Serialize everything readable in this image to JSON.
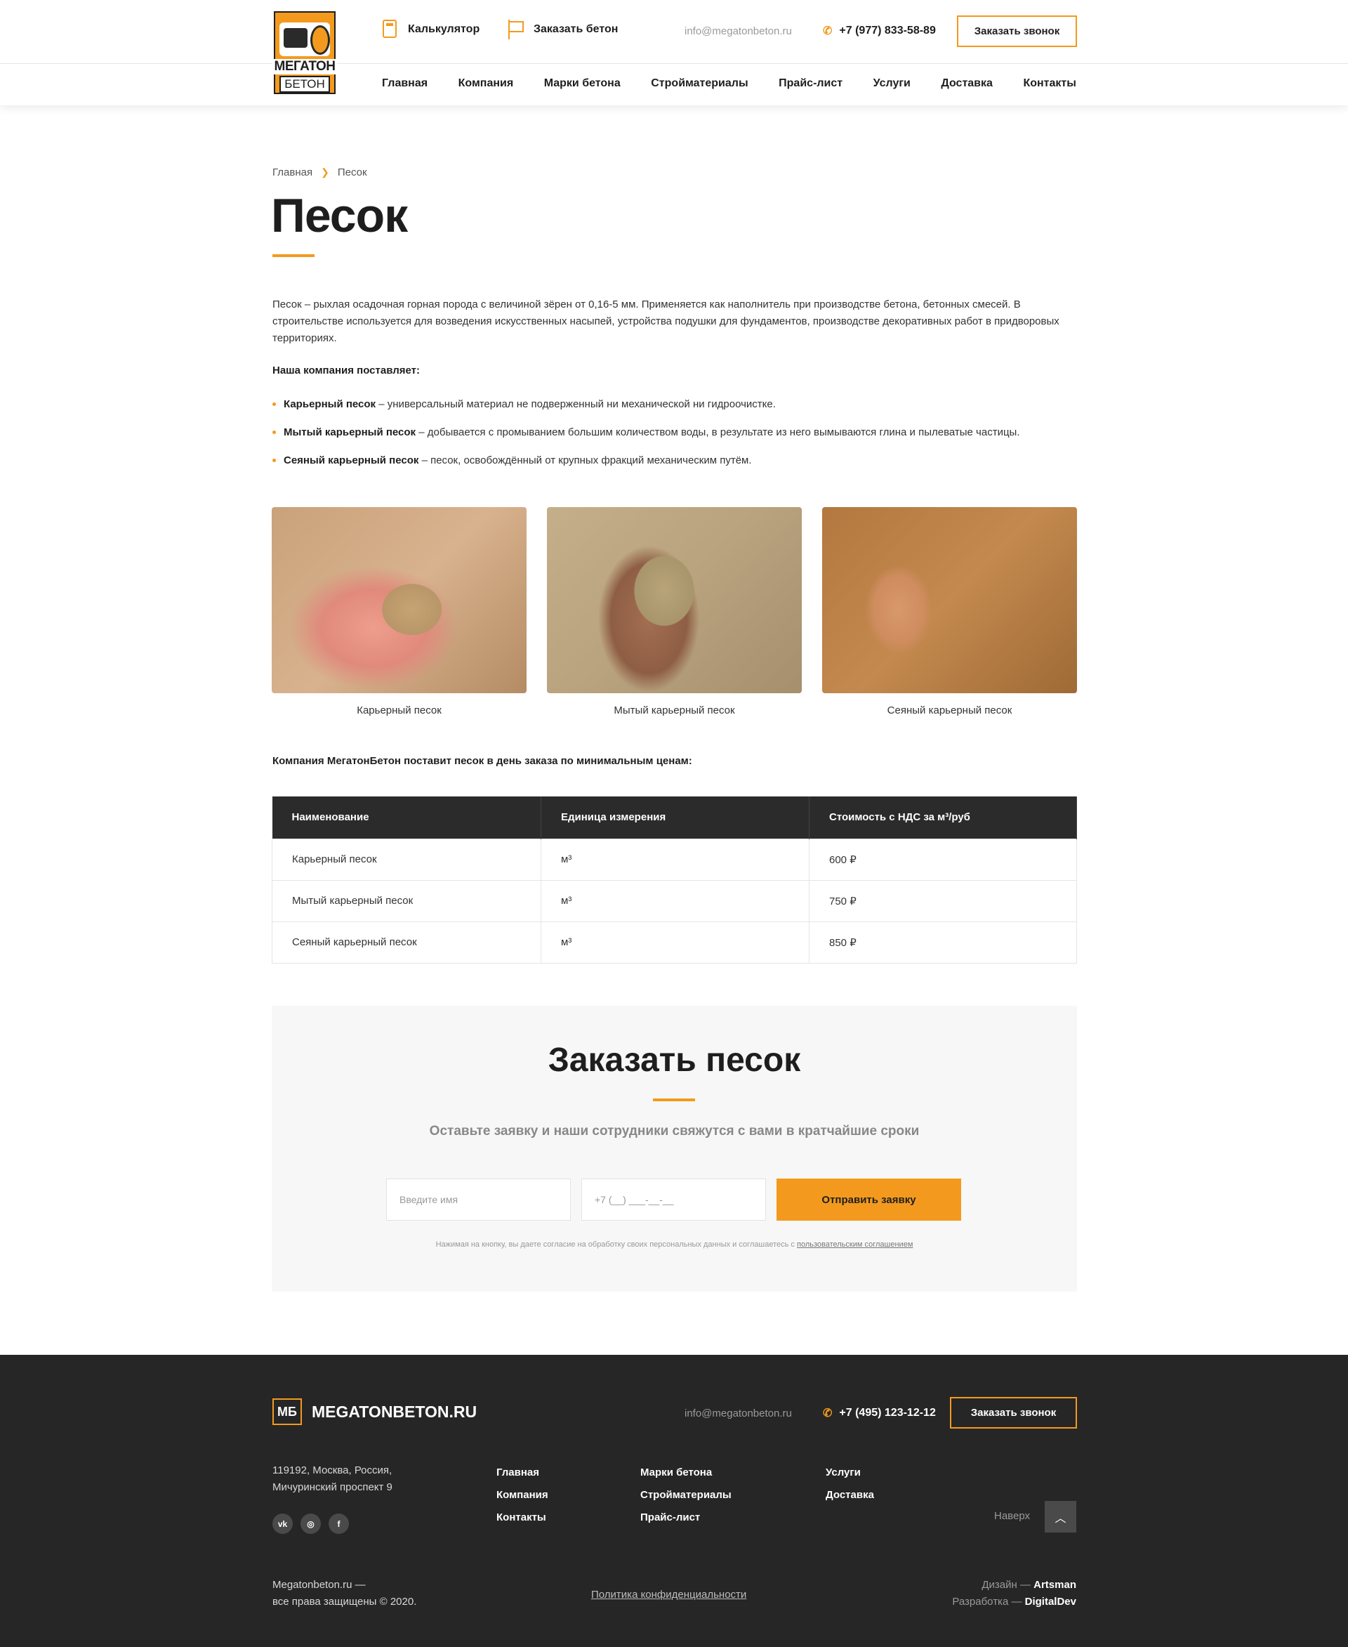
{
  "header": {
    "logo_line1": "МЕГАТОН",
    "logo_line2": "БЕТОН",
    "calculator": "Калькулятор",
    "order_concrete": "Заказать бетон",
    "email": "info@megatonbeton.ru",
    "phone": "+7 (977) 833-58-89",
    "callback": "Заказать звонок",
    "nav": [
      "Главная",
      "Компания",
      "Марки бетона",
      "Стройматериалы",
      "Прайс-лист",
      "Услуги",
      "Доставка",
      "Контакты"
    ]
  },
  "breadcrumb": {
    "home": "Главная",
    "current": "Песок"
  },
  "page_title": "Песок",
  "intro": "Песок – рыхлая осадочная горная порода с величиной зёрен от 0,16-5 мм. Применяется как наполнитель при производстве бетона, бетонных смесей. В строительстве используется для возведения искусственных насыпей, устройства подушки для фундаментов, производстве декоративных работ в придворовых территориях.",
  "supply_heading": "Наша компания поставляет:",
  "products": [
    {
      "name": "Карьерный песок",
      "desc": " – универсальный материал не подверженный ни механической ни гидроочистке."
    },
    {
      "name": "Мытый карьерный песок",
      "desc": " – добывается с промыванием большим количеством воды, в результате из него вымываются глина и пылеватые частицы."
    },
    {
      "name": "Сеяный карьерный песок",
      "desc": " – песок, освобождённый от крупных фракций механическим путём."
    }
  ],
  "photos": [
    "Карьерный песок",
    "Мытый карьерный песок",
    "Сеяный карьерный песок"
  ],
  "promo": "Компания МегатонБетон поставит песок в день заказа по минимальным ценам:",
  "table": {
    "headers": [
      "Наименование",
      "Единица измерения",
      "Стоимость с НДС за м³/руб"
    ],
    "rows": [
      [
        "Карьерный песок",
        "м³",
        "600 ₽"
      ],
      [
        "Мытый карьерный песок",
        "м³",
        "750 ₽"
      ],
      [
        "Сеяный карьерный песок",
        "м³",
        "850 ₽"
      ]
    ]
  },
  "order": {
    "title": "Заказать песок",
    "subtitle": "Оставьте заявку и наши сотрудники свяжутся с вами в кратчайшие сроки",
    "name_placeholder": "Введите имя",
    "phone_placeholder": "+7 (__) ___-__-__",
    "submit": "Отправить заявку",
    "note": "Нажимая на кнопку, вы даете согласие на обработку своих персональных данных и соглашаетесь с ",
    "note_link": "пользовательским соглашением"
  },
  "footer": {
    "logo_mark": "МБ",
    "logo_text": "MEGATONBETON.RU",
    "email": "info@megatonbeton.ru",
    "phone": "+7 (495) 123-12-12",
    "callback": "Заказать звонок",
    "address_line1": "119192, Москва, Россия,",
    "address_line2": "Мичуринский проспект 9",
    "social": [
      "vk-icon",
      "instagram-icon",
      "facebook-icon"
    ],
    "col1": [
      "Главная",
      "Компания",
      "Контакты"
    ],
    "col2": [
      "Марки бетона",
      "Стройматериалы",
      "Прайс-лист"
    ],
    "col3": [
      "Услуги",
      "Доставка"
    ],
    "to_top": "Наверх",
    "copyright_line1": "Megatonbeton.ru —",
    "copyright_line2": "все права защищены © 2020.",
    "privacy": "Политика конфиденциальности",
    "design_label": "Дизайн — ",
    "design_by": "Artsman",
    "dev_label": "Разработка — ",
    "dev_by": "DigitalDev"
  },
  "colors": {
    "accent": "#f39a1e",
    "dark": "#262626"
  }
}
